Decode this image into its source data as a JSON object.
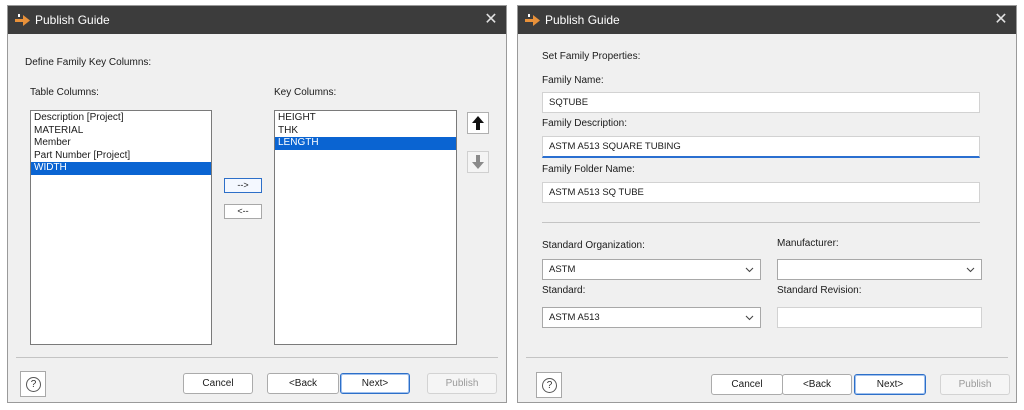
{
  "dialog1": {
    "title": "Publish Guide",
    "close_glyph": "✕",
    "section_label": "Define Family Key Columns:",
    "table_columns_label": "Table Columns:",
    "table_columns": [
      {
        "label": "Description [Project]",
        "selected": false
      },
      {
        "label": "MATERIAL",
        "selected": false
      },
      {
        "label": "Member",
        "selected": false
      },
      {
        "label": "Part Number [Project]",
        "selected": false
      },
      {
        "label": "WIDTH",
        "selected": true
      }
    ],
    "key_columns_label": "Key Columns:",
    "key_columns": [
      {
        "label": "HEIGHT",
        "selected": false
      },
      {
        "label": "THK",
        "selected": false
      },
      {
        "label": "LENGTH",
        "selected": true
      }
    ],
    "add_button": "-->",
    "remove_button": "<--",
    "help_glyph": "?",
    "buttons": {
      "cancel": "Cancel",
      "back": "<Back",
      "next": "Next>",
      "publish": "Publish"
    }
  },
  "dialog2": {
    "title": "Publish Guide",
    "close_glyph": "✕",
    "section_label": "Set Family Properties:",
    "family_name_label": "Family Name:",
    "family_name_value": "SQTUBE",
    "family_description_label": "Family Description:",
    "family_description_value": "ASTM A513 SQUARE TUBING",
    "family_folder_label": "Family Folder Name:",
    "family_folder_value": "ASTM A513 SQ TUBE",
    "standard_org_label": "Standard Organization:",
    "standard_org_value": "ASTM",
    "manufacturer_label": "Manufacturer:",
    "manufacturer_value": "",
    "standard_label": "Standard:",
    "standard_value": "ASTM A513",
    "standard_revision_label": "Standard Revision:",
    "standard_revision_value": "",
    "help_glyph": "?",
    "buttons": {
      "cancel": "Cancel",
      "back": "<Back",
      "next": "Next>",
      "publish": "Publish"
    }
  },
  "colors": {
    "titlebar": "#3c3c3c",
    "selection": "#0a64d2",
    "accent": "#2d6fc8",
    "title_icon": "#e8913a"
  },
  "icons": {
    "title": "publish-guide-logo-icon",
    "up": "arrow-up-icon",
    "down": "arrow-down-icon",
    "chevron": "chevron-down-icon",
    "help": "help-icon",
    "close": "close-icon"
  }
}
